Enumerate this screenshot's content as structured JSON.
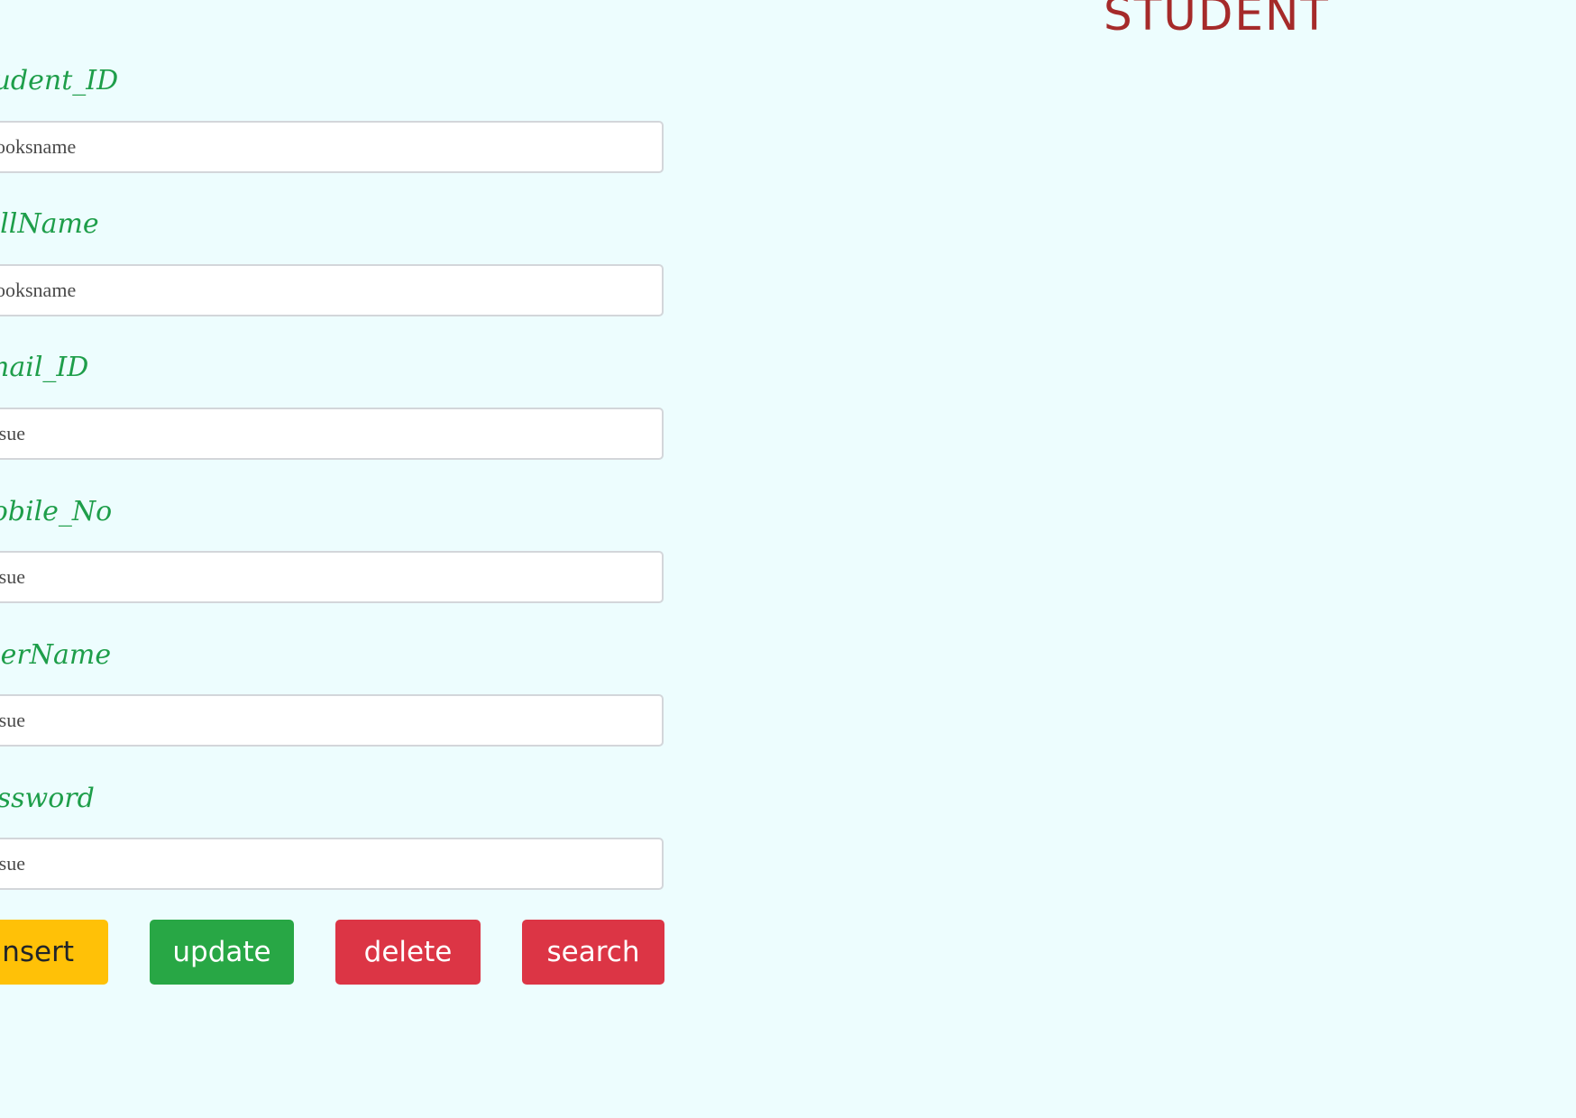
{
  "page": {
    "title": "STUDENT"
  },
  "form": {
    "fields": [
      {
        "label": "Student_ID",
        "placeholder": "booksname"
      },
      {
        "label": "FullName",
        "placeholder": "booksname"
      },
      {
        "label": "Email_ID",
        "placeholder": "issue"
      },
      {
        "label": "Mobile_No",
        "placeholder": "issue"
      },
      {
        "label": "UserName",
        "placeholder": "issue"
      },
      {
        "label": "Password",
        "placeholder": "issue"
      }
    ],
    "buttons": {
      "insert": "insert",
      "update": "update",
      "delete": "delete",
      "search": "search"
    }
  },
  "colors": {
    "background": "#edfdfe",
    "title": "#a52a2a",
    "label": "#1e9e4a",
    "insert": "#ffc107",
    "update": "#28a745",
    "delete": "#dc3545",
    "search": "#dc3545"
  }
}
